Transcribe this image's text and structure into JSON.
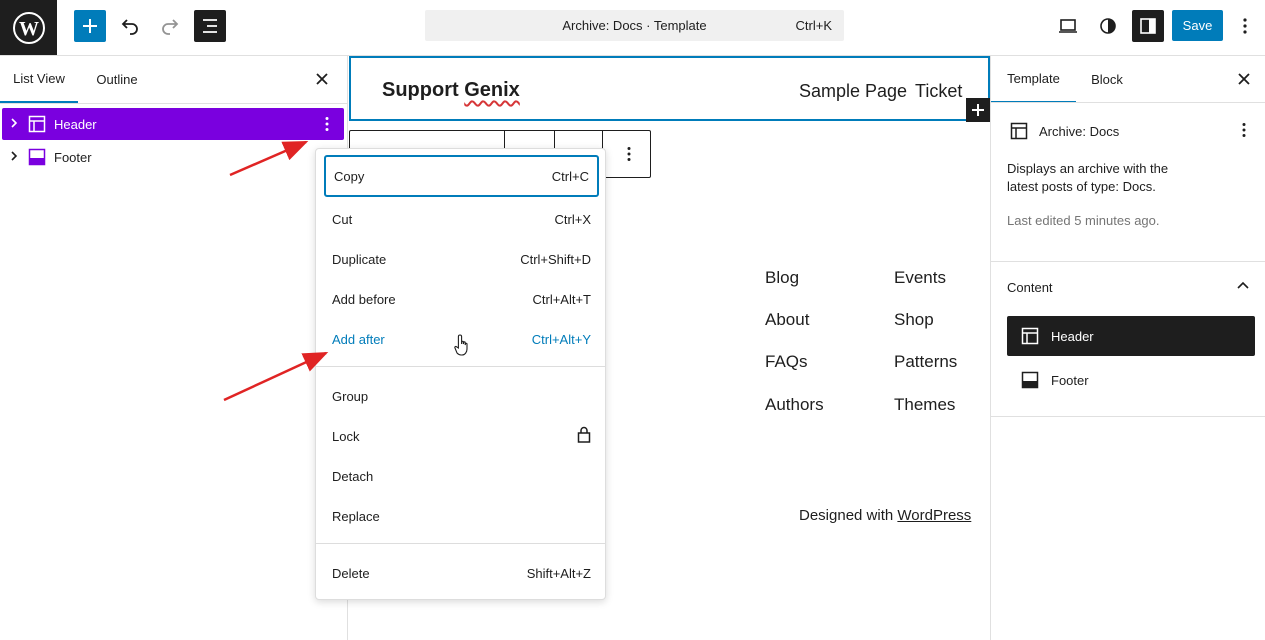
{
  "topbar": {
    "command_bar_label": "Archive: Docs · Template",
    "command_bar_shortcut": "Ctrl+K",
    "save_label": "Save"
  },
  "left_panel": {
    "tabs": [
      {
        "label": "List View"
      },
      {
        "label": "Outline"
      }
    ],
    "items": [
      {
        "label": "Header"
      },
      {
        "label": "Footer"
      }
    ]
  },
  "canvas": {
    "site_title_prefix": "Support ",
    "site_title_underlined": "Genix",
    "nav": [
      "Sample Page",
      "Ticket"
    ],
    "footer_links_col1": [
      "Blog",
      "About",
      "FAQs",
      "Authors"
    ],
    "footer_links_col2": [
      "Events",
      "Shop",
      "Patterns",
      "Themes"
    ],
    "designed_with_prefix": "Designed with ",
    "designed_with_link": "WordPress"
  },
  "context_menu": {
    "items": [
      {
        "label": "Copy",
        "shortcut": "Ctrl+C"
      },
      {
        "label": "Cut",
        "shortcut": "Ctrl+X"
      },
      {
        "label": "Duplicate",
        "shortcut": "Ctrl+Shift+D"
      },
      {
        "label": "Add before",
        "shortcut": "Ctrl+Alt+T"
      },
      {
        "label": "Add after",
        "shortcut": "Ctrl+Alt+Y"
      },
      {
        "label": "Group"
      },
      {
        "label": "Lock"
      },
      {
        "label": "Detach"
      },
      {
        "label": "Replace"
      },
      {
        "label": "Delete",
        "shortcut": "Shift+Alt+Z"
      }
    ]
  },
  "right_panel": {
    "tabs": [
      {
        "label": "Template"
      },
      {
        "label": "Block"
      }
    ],
    "template_title": "Archive: Docs",
    "template_description": "Displays an archive with the latest posts of type: Docs.",
    "last_edited": "Last edited 5 minutes ago.",
    "content_heading": "Content",
    "content_items": [
      {
        "label": "Header"
      },
      {
        "label": "Footer"
      }
    ]
  },
  "colors": {
    "accent": "#007cba",
    "selection_purple": "#7a00df",
    "annotation_red": "#e02424"
  }
}
